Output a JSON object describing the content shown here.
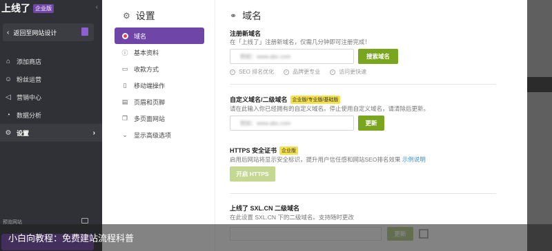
{
  "brand": {
    "name": "上线了",
    "badge": "企业版"
  },
  "sidebar": {
    "back_label": "返回至网站设计",
    "items": [
      {
        "label": "添加商店",
        "icon": "store-icon"
      },
      {
        "label": "粉丝运营",
        "icon": "fans-icon"
      },
      {
        "label": "营销中心",
        "icon": "megaphone-icon"
      },
      {
        "label": "数据分析",
        "icon": "pie-chart-icon"
      },
      {
        "label": "设置",
        "icon": "gear-icon",
        "active": true
      }
    ],
    "preview_label": "预览网站"
  },
  "settings": {
    "title": "设置",
    "menu": [
      {
        "label": "域名",
        "active": true
      },
      {
        "label": "基本资料"
      },
      {
        "label": "收款方式"
      },
      {
        "label": "移动端操作"
      },
      {
        "label": "页眉和页脚"
      },
      {
        "label": "多页面网站"
      },
      {
        "label": "显示高级选项"
      }
    ]
  },
  "domain": {
    "title": "域名",
    "register": {
      "title": "注册新域名",
      "desc": "在「上线了」注册新域名，仅需几分钟即可注册完成！",
      "placeholder": "例如：www.abc.com",
      "button": "搜索域名",
      "features": [
        "SEO 排名优化",
        "品牌更专业",
        "访问更快速"
      ]
    },
    "custom": {
      "title": "自定义域名/二级域名",
      "tag": "企业版/专业版/基础版",
      "desc": "请在此输入你已经拥有的自定义域名。停止使用自定义域名，请清除后更新。",
      "placeholder": "例如：www.abc.com",
      "button": "更新"
    },
    "https": {
      "title": "HTTPS 安全证书",
      "tag": "企业版",
      "desc": "启用后网站将显示安全标识，提升用户信任感和网站SEO排名效果",
      "link": "示例说明",
      "button": "开启 HTTPS"
    },
    "sxl": {
      "title": "上线了 SXL.CN 二级域名",
      "desc": "在此设置 SXL.CN 下的二级域名。支持随时更改",
      "button": "更新"
    }
  },
  "caption": "小白向教程：免费建站流程科普",
  "colors": {
    "accent": "#6f45a8",
    "green": "#7aa51e",
    "tag": "#f4e04d"
  }
}
